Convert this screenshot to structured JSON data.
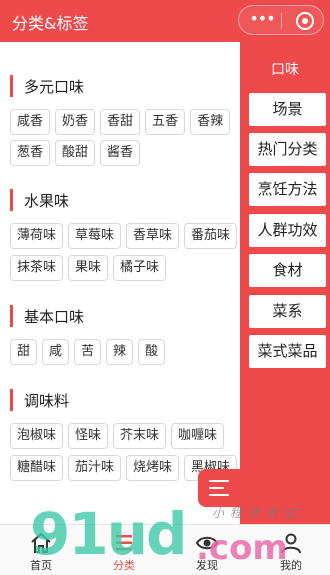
{
  "navbar": {
    "title": "分类&标签",
    "capsule_more": "•••"
  },
  "sections": [
    {
      "title": "多元口味",
      "rows": [
        [
          "咸香",
          "奶香",
          "香甜",
          "五香",
          "香辣"
        ],
        [
          "葱香",
          "酸甜",
          "酱香"
        ]
      ]
    },
    {
      "title": "水果味",
      "rows": [
        [
          "薄荷味",
          "草莓味",
          "香草味",
          "番茄味"
        ],
        [
          "抹茶味",
          "果味",
          "橘子味"
        ]
      ]
    },
    {
      "title": "基本口味",
      "rows": [
        [
          "甜",
          "咸",
          "苦",
          "辣",
          "酸"
        ]
      ]
    },
    {
      "title": "调味料",
      "rows": [
        [
          "泡椒味",
          "怪味",
          "芥末味",
          "咖喱味"
        ],
        [
          "糖醋味",
          "茄汁味",
          "烧烤味",
          "黑椒味"
        ]
      ]
    }
  ],
  "sidebar": {
    "active": "口味",
    "items": [
      "场景",
      "热门分类",
      "烹饪方法",
      "人群功效",
      "食材",
      "菜系",
      "菜式菜品"
    ]
  },
  "tabbar": {
    "items": [
      "首页",
      "分类",
      "发现",
      "我的"
    ]
  },
  "watermark": {
    "logo": "91ud",
    "suffix": ".com",
    "tagline": "小程序商店"
  },
  "colors": {
    "accent": "#ee4a4b",
    "tag_border": "#d8d8d8",
    "watermark_teal": "#3fc9a6"
  }
}
